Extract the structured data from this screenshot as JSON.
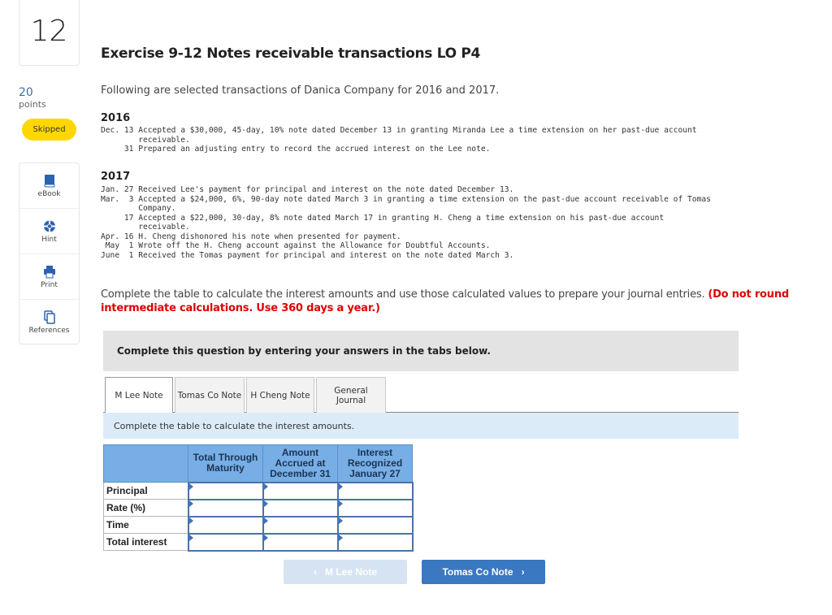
{
  "question": {
    "number": "12",
    "points_value": "20",
    "points_label": "points",
    "status": "Skipped"
  },
  "tools": [
    {
      "label": "eBook",
      "icon": "book-icon"
    },
    {
      "label": "Hint",
      "icon": "lifebuoy-icon"
    },
    {
      "label": "Print",
      "icon": "printer-icon"
    },
    {
      "label": "References",
      "icon": "copy-documents-icon"
    }
  ],
  "exercise": {
    "title": "Exercise 9-12 Notes receivable transactions LO P4",
    "intro": "Following are selected transactions of Danica Company for 2016 and 2017.",
    "years": [
      {
        "year": "2016",
        "lines": [
          "Dec. 13 Accepted a $30,000, 45-day, 10% note dated December 13 in granting Miranda Lee a time extension on her past-due account",
          "        receivable.",
          "     31 Prepared an adjusting entry to record the accrued interest on the Lee note."
        ]
      },
      {
        "year": "2017",
        "lines": [
          "Jan. 27 Received Lee's payment for principal and interest on the note dated December 13.",
          "Mar.  3 Accepted a $24,000, 6%, 90-day note dated March 3 in granting a time extension on the past-due account receivable of Tomas",
          "        Company.",
          "     17 Accepted a $22,000, 30-day, 8% note dated March 17 in granting H. Cheng a time extension on his past-due account",
          "        receivable.",
          "Apr. 16 H. Cheng dishonored his note when presented for payment.",
          " May  1 Wrote off the H. Cheng account against the Allowance for Doubtful Accounts.",
          "June  1 Received the Tomas payment for principal and interest on the note dated March 3."
        ]
      }
    ],
    "instruction": "Complete the table to calculate the interest amounts and use those calculated values to prepare your journal entries. ",
    "instruction_emphasis": "(Do not round intermediate calculations. Use 360 days a year.)"
  },
  "answer_area": {
    "banner": "Complete this question by entering your answers in the tabs below.",
    "tabs": [
      {
        "label": "M Lee Note",
        "active": true
      },
      {
        "label": "Tomas Co Note",
        "active": false
      },
      {
        "label": "H Cheng Note",
        "active": false
      },
      {
        "label": "General Journal",
        "active": false
      }
    ],
    "subtitle": "Complete the table to calculate the interest amounts.",
    "table": {
      "columns": [
        "",
        "Total Through Maturity",
        "Amount Accrued at December 31",
        "Interest Recognized January 27"
      ],
      "rows": [
        {
          "label": "Principal",
          "values": [
            "",
            "",
            ""
          ]
        },
        {
          "label": "Rate (%)",
          "values": [
            "",
            "",
            ""
          ]
        },
        {
          "label": "Time",
          "values": [
            "",
            "",
            ""
          ]
        },
        {
          "label": "Total interest",
          "values": [
            "",
            "",
            ""
          ]
        }
      ]
    },
    "nav": {
      "prev_label": "M Lee Note",
      "prev_icon": "chevron-left-icon",
      "prev_disabled": true,
      "next_label": "Tomas Co Note",
      "next_icon": "chevron-right-icon"
    }
  },
  "colors": {
    "skipped_badge": "#ffd700",
    "emphasis_red": "#e00000",
    "table_header": "#77aee6",
    "next_button": "#3a78c2",
    "prev_button_disabled": "#d6e3f2",
    "subbar": "#dcebf8",
    "banner": "#e3e3e3"
  }
}
